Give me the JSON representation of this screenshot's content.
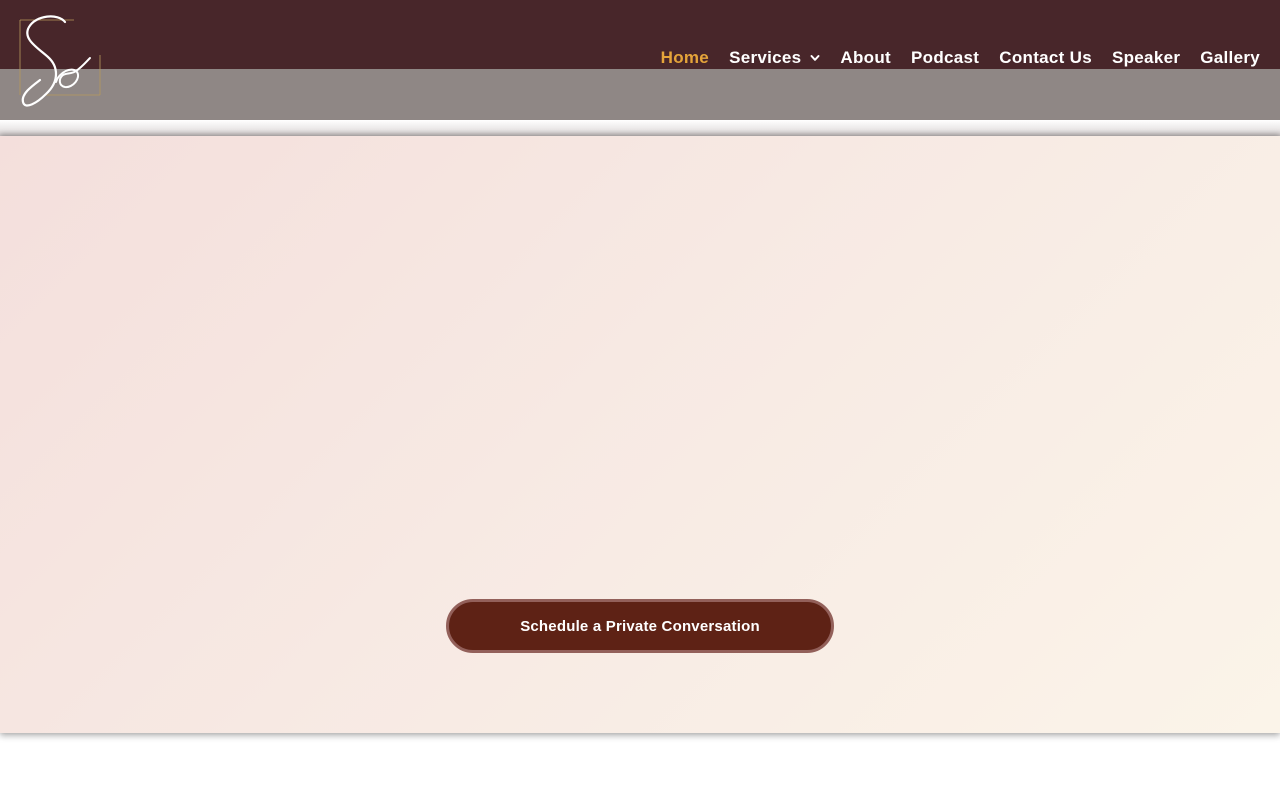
{
  "nav": {
    "items": [
      {
        "label": "Home",
        "active": true
      },
      {
        "label": "Services",
        "has_dropdown": true
      },
      {
        "label": "About"
      },
      {
        "label": "Podcast"
      },
      {
        "label": "Contact Us"
      },
      {
        "label": "Speaker"
      },
      {
        "label": "Gallery"
      }
    ]
  },
  "hero": {
    "cta_label": "Schedule a Private Conversation"
  },
  "colors": {
    "header": "#48262a",
    "header_band": "#8f8785",
    "nav_active": "#e5a43a",
    "cta_bg": "#5e2215",
    "cta_border": "#93605a"
  },
  "icons": {
    "logo": "so-script-logo",
    "dropdown": "chevron-down-icon"
  }
}
